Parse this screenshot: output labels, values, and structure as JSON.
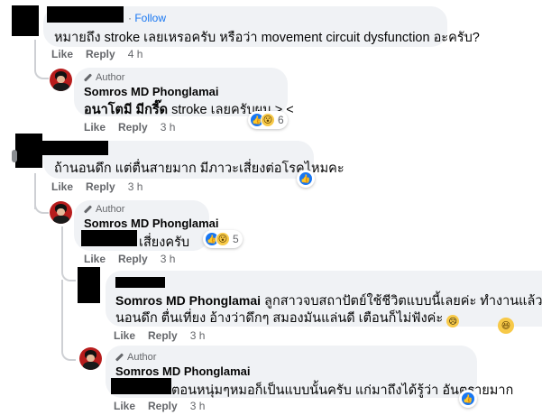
{
  "comments": [
    {
      "follow_label": "Follow",
      "text": "หมายถึง stroke เลยเหรอครับ หรือว่า movement circuit dysfunction อะครับ?",
      "like": "Like",
      "reply": "Reply",
      "time": "4 h",
      "replies": [
        {
          "author_badge": "Author",
          "name": "Somros MD Phonglamai",
          "text_bold": "อนาโตมี มีกรี๊ด",
          "text": " stroke เลยครับผม > <",
          "reaction_count": "6",
          "like": "Like",
          "reply": "Reply",
          "time": "3 h"
        }
      ]
    },
    {
      "text": "ถ้านอนดึก แต่ตื่นสายมาก มีภาวะเสี่ยงต่อโรคไหมคะ",
      "like": "Like",
      "reply": "Reply",
      "time": "3 h",
      "replies": [
        {
          "author_badge": "Author",
          "name": "Somros MD Phonglamai",
          "text": "เสี่ยงครับ",
          "reaction_count": "5",
          "like": "Like",
          "reply": "Reply",
          "time": "3 h",
          "replies": [
            {
              "tag": "Somros MD Phonglamai",
              "text_line1": " ลูกสาวจบสถาปัตย์ใช้ชีวิตแบบนี้เลยค่ะ ทำงานแล้ว",
              "text_line2": "นอนดึก ตื่นเที่ยง อ้างว่าดึกๆ สมองมันแล่นดี เตือนก็ไม่ฟังค่ะ",
              "like": "Like",
              "reply": "Reply",
              "time": "3 h"
            },
            {
              "author_badge": "Author",
              "name": "Somros MD Phonglamai",
              "text": "ตอนหนุ่มๆหมอก็เป็นแบบนั้นครับ แก่มาถึงได้รู้ว่า อันตรายมาก",
              "like": "Like",
              "reply": "Reply",
              "time": "3 h"
            }
          ]
        }
      ]
    }
  ]
}
